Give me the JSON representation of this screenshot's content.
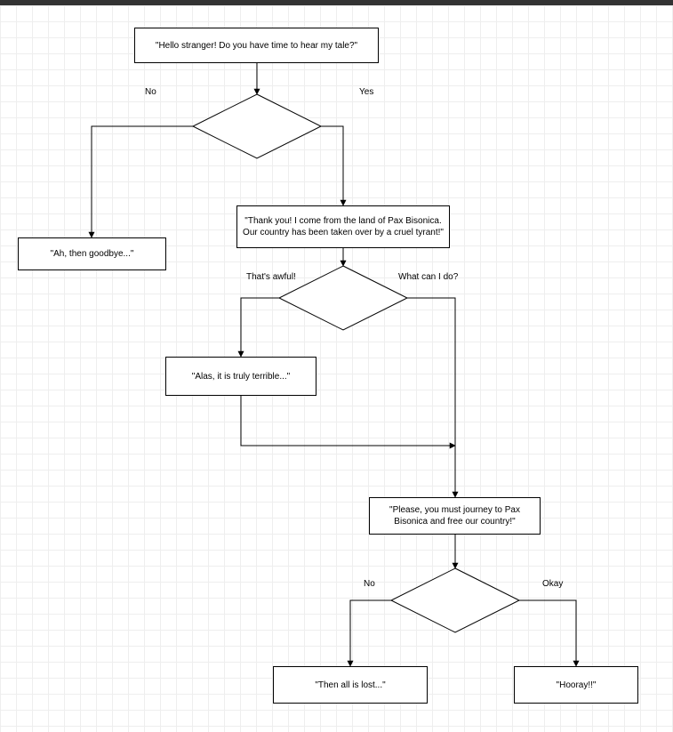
{
  "diagram": {
    "type": "flowchart",
    "nodes": {
      "n1": {
        "text": "\"Hello stranger! Do you have time to hear my tale?\""
      },
      "n2": {
        "text": "\"Ah, then goodbye...\""
      },
      "n3": {
        "text": "\"Thank you! I come from the land of Pax Bisonica. Our country has been taken over by a cruel tyrant!\""
      },
      "n4": {
        "text": "\"Alas, it is truly terrible...\""
      },
      "n5": {
        "text": "\"Please, you must journey to Pax Bisonica and free our country!\""
      },
      "n6": {
        "text": "\"Then all is lost...\""
      },
      "n7": {
        "text": "\"Hooray!!\""
      }
    },
    "edgeLabels": {
      "d1_no": "No",
      "d1_yes": "Yes",
      "d2_left": "That's awful!",
      "d2_right": "What can I do?",
      "d3_no": "No",
      "d3_okay": "Okay"
    }
  }
}
